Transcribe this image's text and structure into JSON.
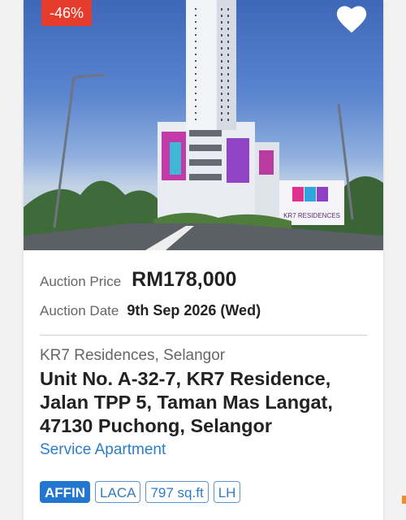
{
  "listing": {
    "discount": "-46%",
    "photo_sign_text": "KR7 RESIDENCES",
    "price_label": "Auction Price",
    "price": "RM178,000",
    "date_label": "Auction Date",
    "date": "9th Sep 2026 (Wed)",
    "location": "KR7 Residences, Selangor",
    "address_lines": [
      "Unit No. A-32-7, KR7 Residence,",
      "Jalan TPP 5, Taman Mas Langat,",
      "47130 Puchong, Selangor"
    ],
    "property_type": "Service Apartment",
    "tags": {
      "bank": "AFFIN",
      "type": "LACA",
      "size": "797 sq.ft",
      "tenure": "LH"
    }
  },
  "icons": {
    "favorite": "heart-icon"
  },
  "colors": {
    "discount_badge": "#e53c2d",
    "accent_blue": "#2c7cc8",
    "bank_tag": "#2376cf"
  }
}
